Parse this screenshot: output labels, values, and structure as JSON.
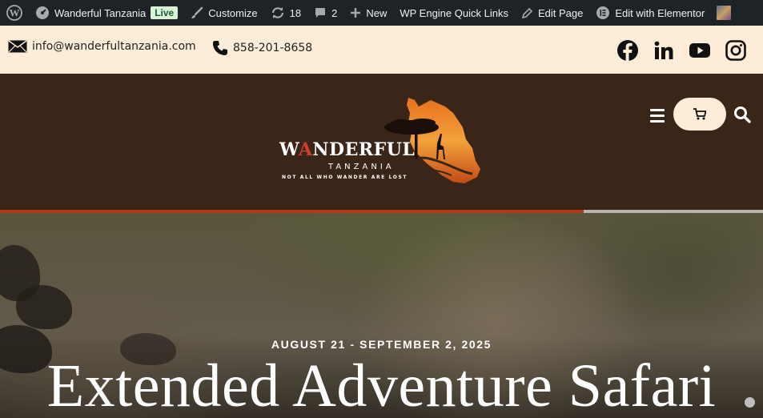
{
  "adminbar": {
    "site_name": "Wanderful Tanzania",
    "live_badge": "Live",
    "customize": "Customize",
    "updates_count": "18",
    "comments_count": "2",
    "new": "New",
    "quick_links": "WP Engine Quick Links",
    "edit_page": "Edit Page",
    "edit_elementor": "Edit with Elementor"
  },
  "topbar": {
    "email": "info@wanderfultanzania.com",
    "phone": "858-201-8658",
    "social": [
      "facebook",
      "linkedin",
      "youtube",
      "instagram"
    ]
  },
  "header": {
    "logo_word_a": "W",
    "logo_word_red": "A",
    "logo_word_b": "NDERFUL",
    "logo_sub": "TANZANIA",
    "logo_tagline": "NOT ALL WHO WANDER ARE LOST",
    "cart_icon": "cart-icon",
    "menu_icon": "hamburger-icon",
    "search_icon": "search-icon"
  },
  "slider": {
    "progress": 0.765
  },
  "hero": {
    "date": "AUGUST 21 - SEPTEMBER 2, 2025",
    "title": "Extended Adventure Safari"
  },
  "colors": {
    "adminbar_bg": "#1d2327",
    "topbar_bg": "#fdecd8",
    "header_bg": "#3a2618",
    "accent_red": "#d43b2a",
    "progress_fill": "#b53a17"
  }
}
